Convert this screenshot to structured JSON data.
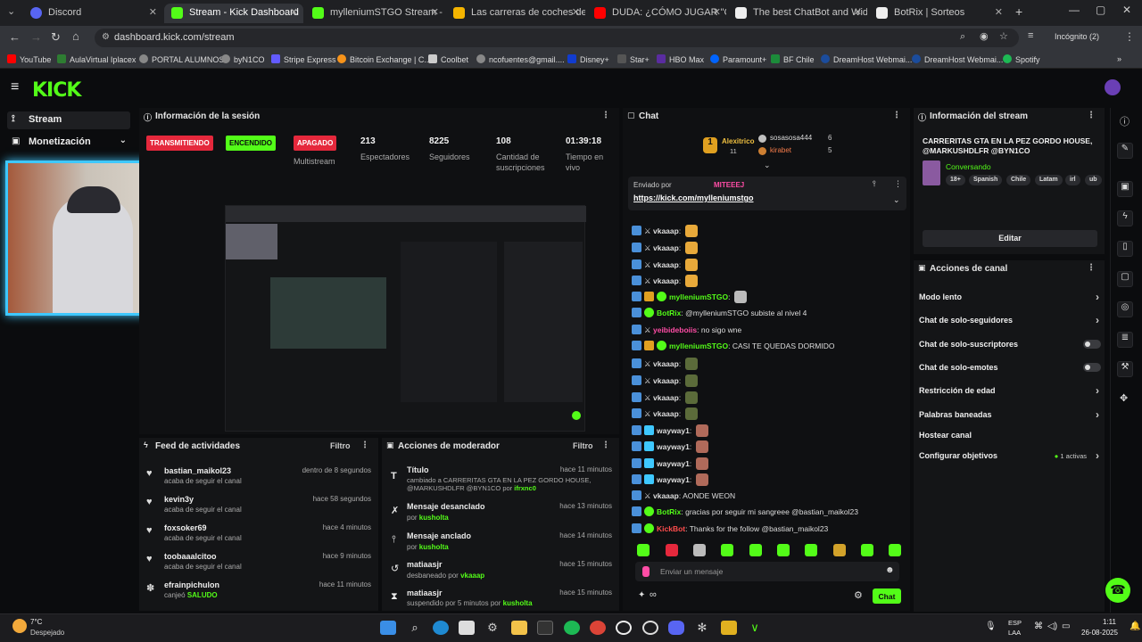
{
  "browser": {
    "tabs": [
      {
        "title": "Discord",
        "color": "#5865f2"
      },
      {
        "title": "Stream - Kick Dashboard",
        "color": "#53fc18",
        "active": true
      },
      {
        "title": "mylleniumSTGO Stream - Watc",
        "color": "#53fc18"
      },
      {
        "title": "Las carreras de coches de com",
        "color": "#f4b400"
      },
      {
        "title": "DUDA: ¿CÓMO JUGAR \"CARRE",
        "color": "#ff0000"
      },
      {
        "title": "The best ChatBot and Widgets",
        "color": "#eeeeee"
      },
      {
        "title": "BotRix | Sorteos",
        "color": "#eeeeee"
      }
    ],
    "url": "dashboard.kick.com/stream",
    "profile": "Incógnito (2)",
    "bookmarks": [
      "YouTube",
      "AulaVirtual Iplacex",
      "PORTAL ALUMNOS",
      "byN1CO",
      "Stripe Express",
      "Bitcoin Exchange | C...",
      "Coolbet",
      "ncofuentes@gmail....",
      "Disney+",
      "Star+",
      "HBO Max",
      "Paramount+",
      "BF Chile",
      "DreamHost Webmai...",
      "DreamHost Webmai...",
      "Spotify"
    ]
  },
  "kick": {
    "logo": "KICK"
  },
  "sidebar": {
    "stream": "Stream",
    "monetization": "Monetización"
  },
  "session": {
    "title": "Información de la sesión",
    "badges": [
      {
        "label": "TRANSMITIENDO",
        "color": "#e5283c"
      },
      {
        "label": "ENCENDIDO",
        "color": "#53fc18"
      },
      {
        "label": "APAGADO",
        "color": "#e5283c"
      }
    ],
    "multistream": "Multistream",
    "stats": [
      {
        "value": "213",
        "label": "Espectadores"
      },
      {
        "value": "8225",
        "label": "Seguidores"
      },
      {
        "value": "108",
        "label": "Cantidad de suscripciones"
      },
      {
        "value": "01:39:18",
        "label": "Tiempo en vivo"
      }
    ]
  },
  "feed": {
    "title": "Feed de actividades",
    "filter": "Filtro",
    "items": [
      {
        "name": "bastian_maikol23",
        "sub": "acaba de seguir el canal",
        "time": "dentro de 8 segundos"
      },
      {
        "name": "kevin3y",
        "sub": "acaba de seguir el canal",
        "time": "hace 58 segundos"
      },
      {
        "name": "foxsoker69",
        "sub": "acaba de seguir el canal",
        "time": "hace 4 minutos"
      },
      {
        "name": "toobaaalcitoo",
        "sub": "acaba de seguir el canal",
        "time": "hace 9 minutos"
      },
      {
        "name": "efrainpichulon",
        "sub": "canjeó",
        "sub_hl": "SALUDO",
        "time": "hace 11 minutos"
      }
    ]
  },
  "modactions": {
    "title": "Acciones de moderador",
    "filter": "Filtro",
    "items": [
      {
        "title": "Título",
        "sub": "cambiado a CARRERITAS GTA EN LA PEZ GORDO HOUSE, @MARKUSHDLFR @BYN1CO por",
        "by": "ifrxnc0",
        "time": "hace 11 minutos"
      },
      {
        "title": "Mensaje desanclado",
        "sub": "por",
        "by": "kusholta",
        "time": "hace 13 minutos"
      },
      {
        "title": "Mensaje anclado",
        "sub": "por",
        "by": "kusholta",
        "time": "hace 14 minutos"
      },
      {
        "title": "matiaasjr",
        "sub": "desbaneado por",
        "by": "vkaaap",
        "time": "hace 15 minutos"
      },
      {
        "title": "matiaasjr",
        "sub": "suspendido por 5 minutos por",
        "by": "kusholta",
        "time": "hace 15 minutos"
      }
    ]
  },
  "chat": {
    "title": "Chat",
    "top_gifters": [
      {
        "name": "Alexitrico",
        "count": "11"
      },
      {
        "name": "sosasosa444",
        "count": "6"
      },
      {
        "name": "kirabet",
        "count": "5"
      }
    ],
    "pinned_by": "Enviado por",
    "pinned_user": "MITEEEJ",
    "pinned_link": "https://kick.com/mylleniumstgo",
    "messages": [
      {
        "user": "vkaaap",
        "color": "#ffffff",
        "text": ""
      },
      {
        "user": "vkaaap",
        "color": "#ffffff",
        "text": ""
      },
      {
        "user": "vkaaap",
        "color": "#ffffff",
        "text": ""
      },
      {
        "user": "vkaaap",
        "color": "#ffffff",
        "text": ""
      },
      {
        "user": "mylleniumSTGO",
        "color": "#53fc18",
        "text": ""
      },
      {
        "user": "BotRix",
        "color": "#53fc18",
        "text": "@mylleniumSTGO subiste al nivel 4"
      },
      {
        "user": "yeibideboiis",
        "color": "#ff4da6",
        "text": "no sigo wne"
      },
      {
        "user": "mylleniumSTGO",
        "color": "#53fc18",
        "text": "CASI TE QUEDAS DORMIDO"
      },
      {
        "user": "vkaaap",
        "color": "#ffffff",
        "text": ""
      },
      {
        "user": "vkaaap",
        "color": "#ffffff",
        "text": ""
      },
      {
        "user": "vkaaap",
        "color": "#ffffff",
        "text": ""
      },
      {
        "user": "vkaaap",
        "color": "#ffffff",
        "text": ""
      },
      {
        "user": "wayway1",
        "color": "#ffffff",
        "text": ""
      },
      {
        "user": "wayway1",
        "color": "#ffffff",
        "text": ""
      },
      {
        "user": "wayway1",
        "color": "#ffffff",
        "text": ""
      },
      {
        "user": "wayway1",
        "color": "#ffffff",
        "text": ""
      },
      {
        "user": "vkaaap",
        "color": "#ffffff",
        "text": "AONDE WEON"
      },
      {
        "user": "BotRix",
        "color": "#53fc18",
        "text": "gracias por seguir mi sangreee @bastian_maikol23"
      },
      {
        "user": "KickBot",
        "color": "#ff4d4d",
        "text": "Thanks for the follow @bastian_maikol23"
      }
    ],
    "input_placeholder": "Enviar un mensaje",
    "send": "Chat"
  },
  "stream_info": {
    "title": "Información del stream",
    "stream_title": "CARRERITAS GTA EN LA PEZ GORDO HOUSE, @MARKUSHDLFR @BYN1CO",
    "category": "Conversando",
    "tags": [
      "18+",
      "Spanish",
      "Chile",
      "Latam",
      "irl",
      "ub"
    ],
    "edit": "Editar"
  },
  "channel_actions": {
    "title": "Acciones de canal",
    "items": [
      {
        "label": "Modo lento",
        "type": "chevron"
      },
      {
        "label": "Chat de solo-seguidores",
        "type": "chevron"
      },
      {
        "label": "Chat de solo-suscriptores",
        "type": "toggle"
      },
      {
        "label": "Chat de solo-emotes",
        "type": "toggle"
      },
      {
        "label": "Restricción de edad",
        "type": "chevron"
      },
      {
        "label": "Palabras baneadas",
        "type": "chevron"
      },
      {
        "label": "Hostear canal",
        "type": "none"
      },
      {
        "label": "Configurar objetivos",
        "type": "chevron",
        "extra": "1 activas"
      }
    ]
  },
  "taskbar": {
    "weather_temp": "7°C",
    "weather_desc": "Despejado",
    "lang": "ESP",
    "lang2": "LAA",
    "time": "1:11",
    "date": "26-08-2025"
  }
}
